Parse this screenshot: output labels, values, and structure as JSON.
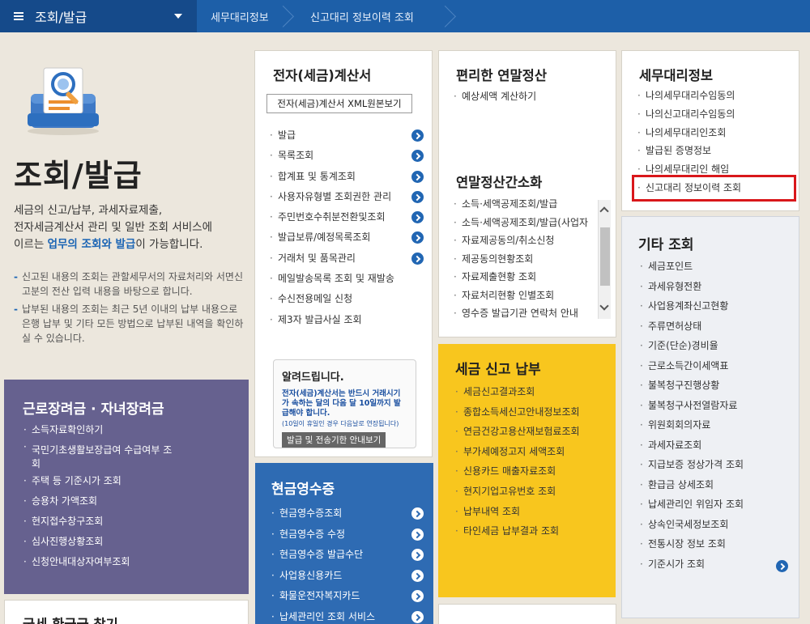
{
  "topbar": {
    "menu_label": "조회/발급",
    "crumbs": [
      "세무대리정보",
      "신고대리 정보이력 조회"
    ]
  },
  "intro": {
    "title": "조회/발급",
    "desc_line1": "세금의 신고/납부, 과세자료제출,",
    "desc_line2": "전자세금계산서 관리 및 일반 조회 서비스에",
    "desc_line3_pre": "이르는 ",
    "desc_line3_hl": "업무의 조회와 발급",
    "desc_line3_post": "이 가능합니다.",
    "notes": [
      "신고된 내용의 조회는 관할세무서의 자료처리와 서면신고분의 전산 입력 내용을 바탕으로 합니다.",
      "납부된 내용의 조회는 최근 5년 이내의 납부 내용으로 은행 납부 및 기타 모든 방법으로 납부된 내역을 확인하실 수 있습니다."
    ]
  },
  "einvoice": {
    "title": "전자(세금)계산서",
    "xml_button": "전자(세금)계산서 XML원본보기",
    "items": [
      "발급",
      "목록조회",
      "합계표 및 통계조회",
      "사용자유형별 조회권한 관리",
      "주민번호수취분전환및조회",
      "발급보류/예정목록조회",
      "거래처 및 품목관리",
      "메일발송목록 조회 및 재발송",
      "수신전용메일 신청",
      "제3자 발급사실 조회"
    ],
    "notice_title": "알려드립니다.",
    "notice_text": "전자(세금)계산서는 반드시 거래시기가 속하는 달의 다음 달 10일까지 발급해야 합니다.",
    "notice_small": "(10일이 휴일인 경우 다음날로 연장됩니다)",
    "notice_button": "발급 및 전송기한 안내보기"
  },
  "yearend": {
    "title": "편리한 연말정산",
    "items": [
      "예상세액 계산하기"
    ]
  },
  "yearend_simple": {
    "title": "연말정산간소화",
    "items": [
      "소득·세액공제조회/발급",
      "소득·세액공제조회/발급(사업자",
      "자료제공동의/취소신청",
      "제공동의현황조회",
      "자료제출현황 조회",
      "자료처리현황 인별조회",
      "영수증 발급기관 연락처 안내"
    ]
  },
  "tax_agent": {
    "title": "세무대리정보",
    "items": [
      "나의세무대리수임동의",
      "나의신고대리수임동의",
      "나의세무대리인조회",
      "발급된 증명정보",
      "나의세무대리인 해임",
      "신고대리 정보이력 조회"
    ]
  },
  "other": {
    "title": "기타 조회",
    "items": [
      "세금포인트",
      "과세유형전환",
      "사업용계좌신고현황",
      "주류면허상태",
      "기준(단순)경비율",
      "근로소득간이세액표",
      "불복청구진행상황",
      "불복청구사전열람자료",
      "위원회회의자료",
      "과세자료조회",
      "지급보증 정상가격 조회",
      "환급금 상세조회",
      "납세관리인 위임자 조회",
      "상속인국세정보조회",
      "전통시장 정보 조회",
      "기준시가 조회"
    ]
  },
  "earned_income": {
    "title": "근로장려금 · 자녀장려금",
    "items": [
      "소득자료확인하기",
      "국민기초생활보장급여 수급여부 조회",
      "주택 등 기준시가 조회",
      "승용차 가액조회",
      "현지접수창구조회",
      "심사진행상황조회",
      "신청안내대상자여부조회"
    ]
  },
  "cash_receipt": {
    "title": "현금영수증",
    "items": [
      "현금영수증조회",
      "현금영수증 수정",
      "현금영수증 발급수단",
      "사업용신용카드",
      "화물운전자복지카드",
      "납세관리인 조회 서비스"
    ]
  },
  "tax_report": {
    "title": "세금 신고 납부",
    "items": [
      "세금신고결과조회",
      "종합소득세신고안내정보조회",
      "연금건강고용산재보험료조회",
      "부가세예정고지 세액조회",
      "신용카드 매출자료조회",
      "현지기업고유번호 조회",
      "납부내역 조회",
      "타인세금 납부결과 조회"
    ]
  },
  "bottom_left_title": "국세 환급금 찾기",
  "colors": {
    "nav_blue": "#1d5fa8",
    "purple": "#66618f",
    "blue": "#2e6bb3",
    "yellow": "#f8c61e",
    "highlight_red": "#d9171b"
  }
}
